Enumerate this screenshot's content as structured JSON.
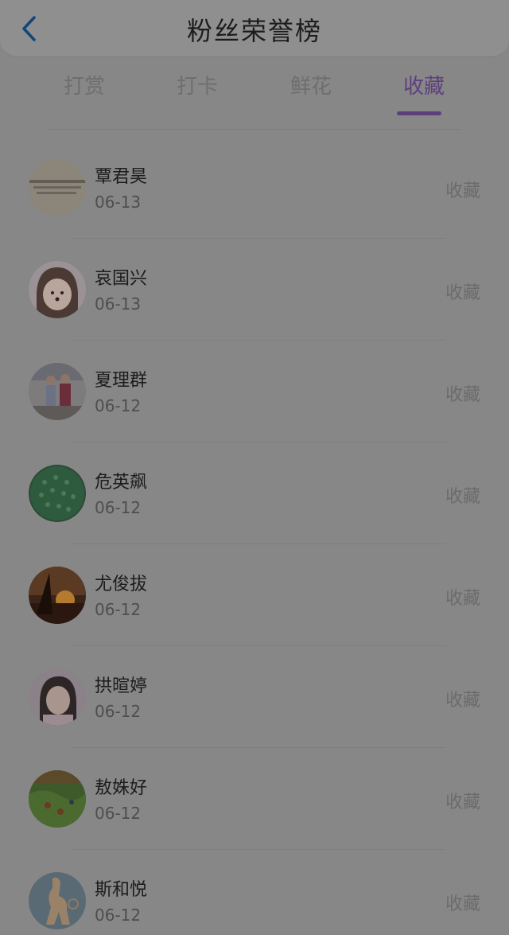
{
  "header": {
    "title": "粉丝荣誉榜"
  },
  "tabs": [
    {
      "label": "打赏"
    },
    {
      "label": "打卡"
    },
    {
      "label": "鲜花"
    },
    {
      "label": "收藏"
    }
  ],
  "active_tab": "收藏",
  "colors": {
    "accent": "#5e3f7e",
    "background": "#878787"
  },
  "list": {
    "items": [
      {
        "name": "覃君昊",
        "date": "06-13",
        "action": "收藏"
      },
      {
        "name": "哀国兴",
        "date": "06-13",
        "action": "收藏"
      },
      {
        "name": "夏理群",
        "date": "06-12",
        "action": "收藏"
      },
      {
        "name": "危英飙",
        "date": "06-12",
        "action": "收藏"
      },
      {
        "name": "尤俊拔",
        "date": "06-12",
        "action": "收藏"
      },
      {
        "name": "拱暄婷",
        "date": "06-12",
        "action": "收藏"
      },
      {
        "name": "敖姝好",
        "date": "06-12",
        "action": "收藏"
      },
      {
        "name": "斯和悦",
        "date": "06-12",
        "action": "收藏"
      }
    ]
  }
}
